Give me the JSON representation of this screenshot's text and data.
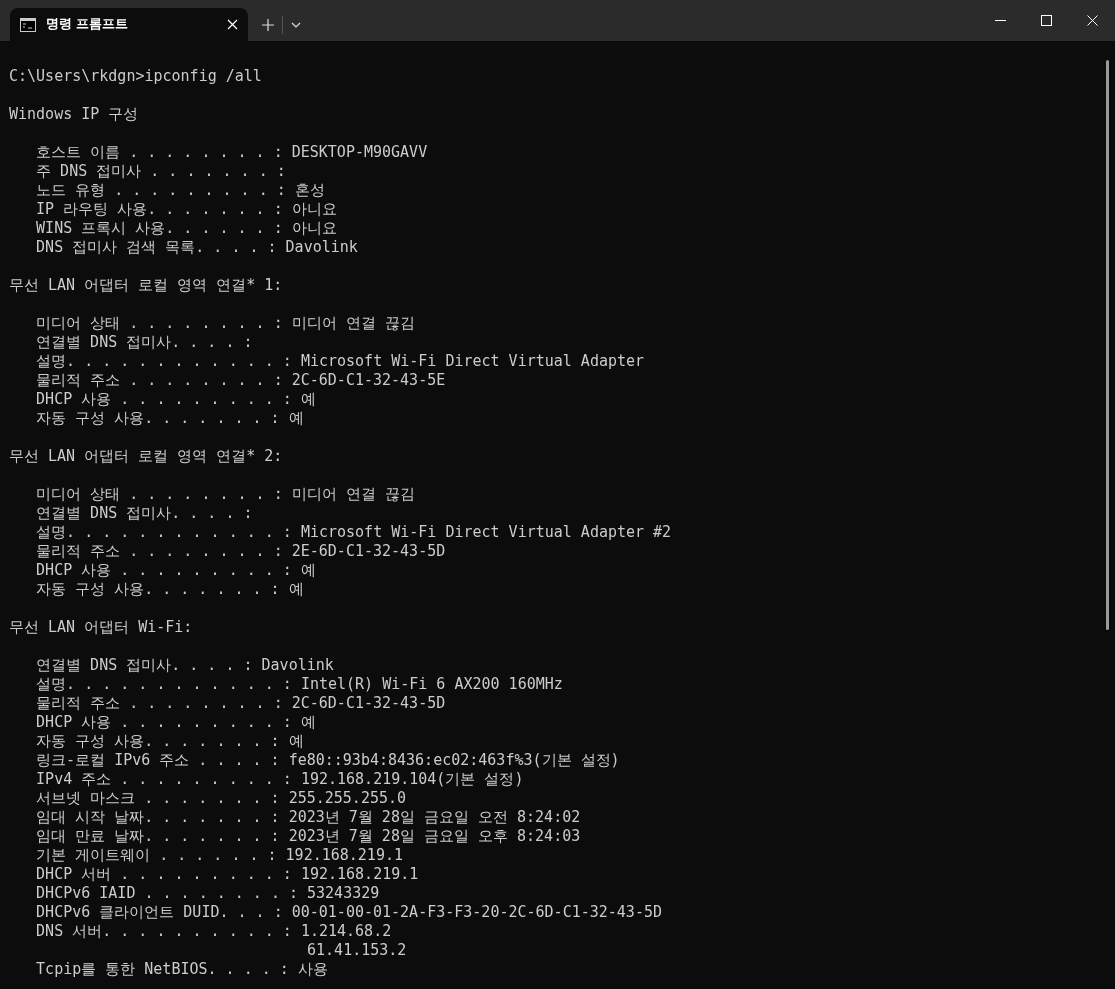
{
  "tabs": [
    {
      "title": "명령 프롬프트",
      "selected": true
    }
  ],
  "terminal": {
    "blocks": [
      [
        "C:\\Users\\rkdgn>ipconfig /all"
      ],
      [
        "Windows IP 구성"
      ],
      [
        "   호스트 이름 . . . . . . . . : DESKTOP-M90GAVV",
        "   주 DNS 접미사 . . . . . . . :",
        "   노드 유형 . . . . . . . . . : 혼성",
        "   IP 라우팅 사용. . . . . . . : 아니요",
        "   WINS 프록시 사용. . . . . . : 아니요",
        "   DNS 접미사 검색 목록. . . . : Davolink"
      ],
      [
        "무선 LAN 어댑터 로컬 영역 연결* 1:"
      ],
      [
        "   미디어 상태 . . . . . . . . : 미디어 연결 끊김",
        "   연결별 DNS 접미사. . . . :",
        "   설명. . . . . . . . . . . . : Microsoft Wi-Fi Direct Virtual Adapter",
        "   물리적 주소 . . . . . . . . : 2C-6D-C1-32-43-5E",
        "   DHCP 사용 . . . . . . . . . : 예",
        "   자동 구성 사용. . . . . . . : 예"
      ],
      [
        "무선 LAN 어댑터 로컬 영역 연결* 2:"
      ],
      [
        "   미디어 상태 . . . . . . . . : 미디어 연결 끊김",
        "   연결별 DNS 접미사. . . . :",
        "   설명. . . . . . . . . . . . : Microsoft Wi-Fi Direct Virtual Adapter #2",
        "   물리적 주소 . . . . . . . . : 2E-6D-C1-32-43-5D",
        "   DHCP 사용 . . . . . . . . . : 예",
        "   자동 구성 사용. . . . . . . : 예"
      ],
      [
        "무선 LAN 어댑터 Wi-Fi:"
      ],
      [
        "   연결별 DNS 접미사. . . . : Davolink",
        "   설명. . . . . . . . . . . . : Intel(R) Wi-Fi 6 AX200 160MHz",
        "   물리적 주소 . . . . . . . . : 2C-6D-C1-32-43-5D",
        "   DHCP 사용 . . . . . . . . . : 예",
        "   자동 구성 사용. . . . . . . : 예",
        "   링크-로컬 IPv6 주소 . . . . : fe80::93b4:8436:ec02:463f%3(기본 설정)",
        "   IPv4 주소 . . . . . . . . . : 192.168.219.104(기본 설정)",
        "   서브넷 마스크 . . . . . . . : 255.255.255.0",
        "   임대 시작 날짜. . . . . . . : 2023년 7월 28일 금요일 오전 8:24:02",
        "   임대 만료 날짜. . . . . . . : 2023년 7월 28일 금요일 오후 8:24:03",
        "   기본 게이트웨이 . . . . . . : 192.168.219.1",
        "   DHCP 서버 . . . . . . . . . : 192.168.219.1",
        "   DHCPv6 IAID . . . . . . . . : 53243329",
        "   DHCPv6 클라이언트 DUID. . . : 00-01-00-01-2A-F3-F3-20-2C-6D-C1-32-43-5D",
        "   DNS 서버. . . . . . . . . . : 1.214.68.2",
        "                                 61.41.153.2",
        "   Tcpip를 통한 NetBIOS. . . . : 사용"
      ]
    ]
  }
}
